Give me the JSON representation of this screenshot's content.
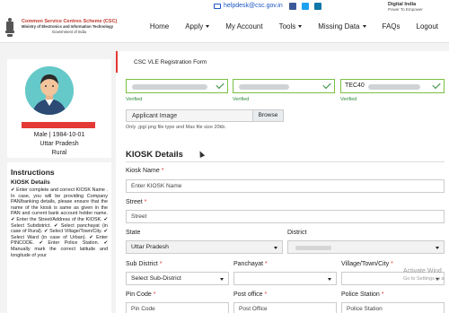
{
  "topbar": {
    "email": "helpdesk@csc.gov.in",
    "digital_india_title": "Digital India",
    "digital_india_tagline": "Power To Empower"
  },
  "brand": {
    "title": "Common Service Centres Scheme (CSC)",
    "ministry": "Ministry of Electronics and Information Technology",
    "government": "Government of India"
  },
  "nav": [
    {
      "label": "Home",
      "dropdown": false
    },
    {
      "label": "Apply",
      "dropdown": true
    },
    {
      "label": "My Account",
      "dropdown": false
    },
    {
      "label": "Tools",
      "dropdown": true
    },
    {
      "label": "Missing Data",
      "dropdown": true
    },
    {
      "label": "FAQs",
      "dropdown": false
    },
    {
      "label": "Logout",
      "dropdown": false
    }
  ],
  "profile": {
    "gender_dob": "Male | 1984-10-01",
    "state": "Uttar Pradesh",
    "area": "Rural"
  },
  "instructions": {
    "title": "Instructions",
    "section": "KIOSK Details",
    "text": "✔ Enter complete and correct KIOSK Name . In case, you will be providing Company PAN/banking details, please ensure that the name of the kiosk is same as given in the PAN and current bank account holder name. ✔ Enter the Street/Address of the KIOSK. ✔ Select Subdistrict. ✔ Select panchayat (in case of Rural). ✔ Select Village/Town/City. ✔ Select Ward (in case of Urban). ✔ Enter PINCODE. ✔ Enter Police Station. ✔ Manually mark the correct latitude and longitude of your"
  },
  "form": {
    "title": "CSC VLE Registration Form",
    "verified_fields": [
      {
        "value": "",
        "status": "Verified"
      },
      {
        "value": "",
        "status": "Verified"
      },
      {
        "value": "TEC40",
        "status": "Verified"
      }
    ],
    "applicant_image_label": "Applicant Image",
    "browse_label": "Browse",
    "file_hint": "Only .jpg/.png file type and Max file size 20kb.",
    "section_title": "KIOSK Details",
    "kiosk_name": {
      "label": "Kiosk Name",
      "placeholder": "Enter KIOSK Name"
    },
    "street": {
      "label": "Street",
      "placeholder": "Street"
    },
    "state": {
      "label": "State",
      "value": "Uttar Pradesh"
    },
    "district": {
      "label": "District",
      "value": ""
    },
    "sub_district": {
      "label": "Sub District",
      "value": "Select Sub-District"
    },
    "panchayat": {
      "label": "Panchayat",
      "value": ""
    },
    "village": {
      "label": "Village/Town/City",
      "value": ""
    },
    "pin_code": {
      "label": "Pin Code",
      "placeholder": "Pin Code"
    },
    "post_office": {
      "label": "Post office",
      "placeholder": "Post Office"
    },
    "police_station": {
      "label": "Police Station",
      "placeholder": "Police Station"
    }
  },
  "watermark": {
    "line1": "Activate Wind",
    "line2": "Go to Settings to a"
  },
  "colors": {
    "accent_red": "#e53935",
    "verified_green": "#7bc142",
    "avatar_bg": "#66c9c9"
  }
}
